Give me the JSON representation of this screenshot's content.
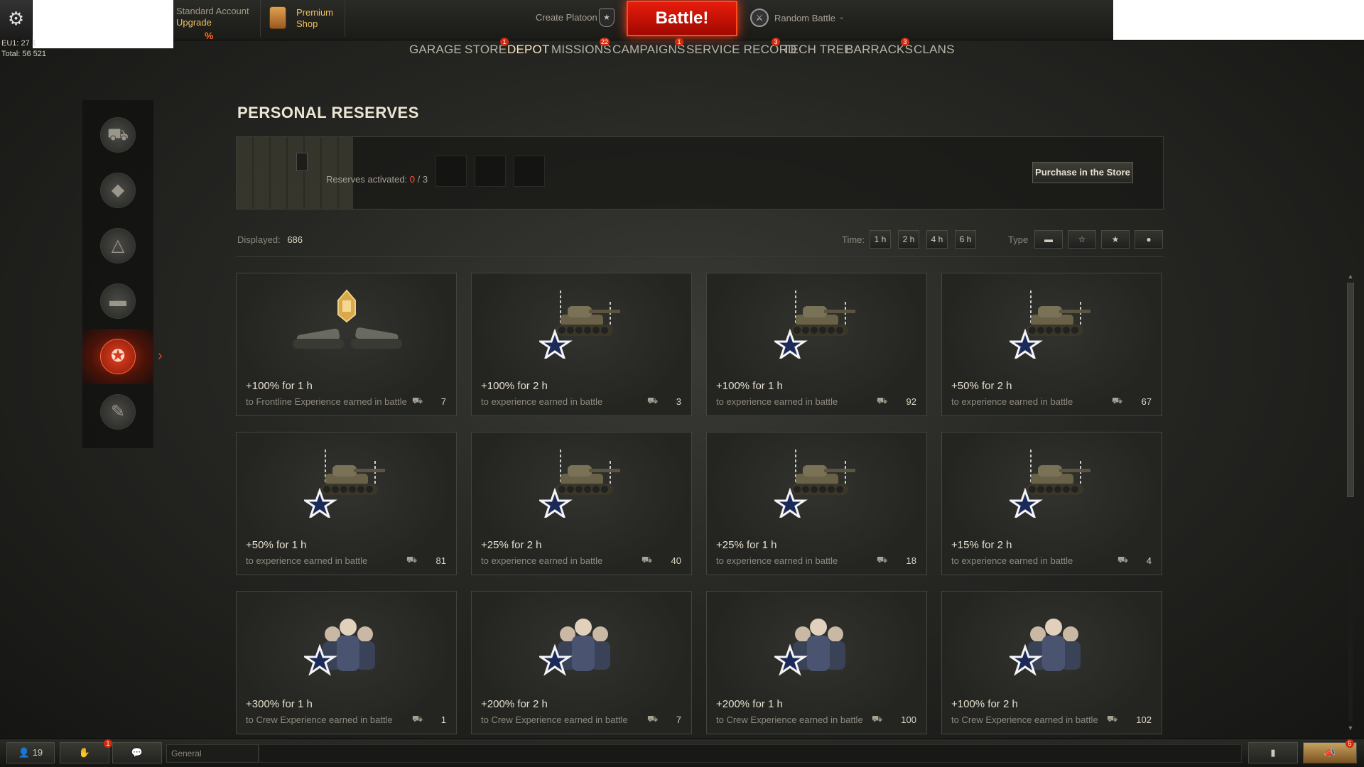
{
  "header": {
    "server_info": "EU1: 27 1",
    "total_online": "Total: 56 521",
    "account_type": "Standard Account",
    "account_upgrade": "Upgrade",
    "discount_badge": "%",
    "premium_shop_line1": "Premium",
    "premium_shop_line2": "Shop",
    "create_platoon": "Create Platoon",
    "battle_button": "Battle!",
    "battle_mode": "Random Battle"
  },
  "nav": [
    {
      "label": "GARAGE",
      "badge": ""
    },
    {
      "label": "STORE",
      "badge": "1"
    },
    {
      "label": "DEPOT",
      "badge": ""
    },
    {
      "label": "MISSIONS",
      "badge": "22"
    },
    {
      "label": "CAMPAIGNS",
      "badge": "1"
    },
    {
      "label": "SERVICE RECORD",
      "badge": "3"
    },
    {
      "label": "TECH TREE",
      "badge": ""
    },
    {
      "label": "BARRACKS",
      "badge": "3"
    },
    {
      "label": "CLANS",
      "badge": ""
    }
  ],
  "active_nav": "DEPOT",
  "sidebar": {
    "items": [
      {
        "icon": "vehicles-icon"
      },
      {
        "icon": "equipment-icon"
      },
      {
        "icon": "blueprints-icon"
      },
      {
        "icon": "tank-icon"
      },
      {
        "icon": "personal-reserves-icon"
      },
      {
        "icon": "customization-icon"
      }
    ],
    "active_index": 4
  },
  "page_title": "PERSONAL RESERVES",
  "reserves": {
    "activated_label": "Reserves activated:",
    "activated_current": "0",
    "activated_max": "3",
    "purchase_button": "Purchase in the Store"
  },
  "filters": {
    "displayed_label": "Displayed:",
    "displayed_value": "686",
    "time_label": "Time:",
    "time_options": [
      "1 h",
      "2 h",
      "4 h",
      "6 h"
    ],
    "type_label": "Type",
    "type_icons": [
      "tank-experience-icon",
      "crew-experience-icon",
      "star-icon",
      "credits-icon"
    ]
  },
  "cards": [
    {
      "title": "+100% for 1 h",
      "desc": "to Frontline Experience earned in battle",
      "count": "7",
      "image": "frontline-tanks-icon"
    },
    {
      "title": "+100% for 2 h",
      "desc": "to experience earned in battle",
      "count": "3",
      "image": "tank-star-icon"
    },
    {
      "title": "+100% for 1 h",
      "desc": "to experience earned in battle",
      "count": "92",
      "image": "tank-star-icon"
    },
    {
      "title": "+50% for 2 h",
      "desc": "to experience earned in battle",
      "count": "67",
      "image": "tank-star-icon"
    },
    {
      "title": "+50% for 1 h",
      "desc": "to experience earned in battle",
      "count": "81",
      "image": "tank-star-icon"
    },
    {
      "title": "+25% for 2 h",
      "desc": "to experience earned in battle",
      "count": "40",
      "image": "tank-star-icon"
    },
    {
      "title": "+25% for 1 h",
      "desc": "to experience earned in battle",
      "count": "18",
      "image": "tank-star-icon"
    },
    {
      "title": "+15% for 2 h",
      "desc": "to experience earned in battle",
      "count": "4",
      "image": "tank-star-icon"
    },
    {
      "title": "+300% for 1 h",
      "desc": "to Crew Experience earned in battle",
      "count": "1",
      "image": "crew-star-icon"
    },
    {
      "title": "+200% for 2 h",
      "desc": "to Crew Experience earned in battle",
      "count": "7",
      "image": "crew-star-icon"
    },
    {
      "title": "+200% for 1 h",
      "desc": "to Crew Experience earned in battle",
      "count": "100",
      "image": "crew-star-icon"
    },
    {
      "title": "+100% for 2 h",
      "desc": "to Crew Experience earned in battle",
      "count": "102",
      "image": "crew-star-icon"
    }
  ],
  "bottom": {
    "online_count": "19",
    "chat_channel": "General",
    "clan_badge": "1",
    "notifications_badge": "5"
  },
  "colors": {
    "accent": "#d8452a",
    "battle_red": "#d01808",
    "highlight_gold": "#f0c060"
  }
}
